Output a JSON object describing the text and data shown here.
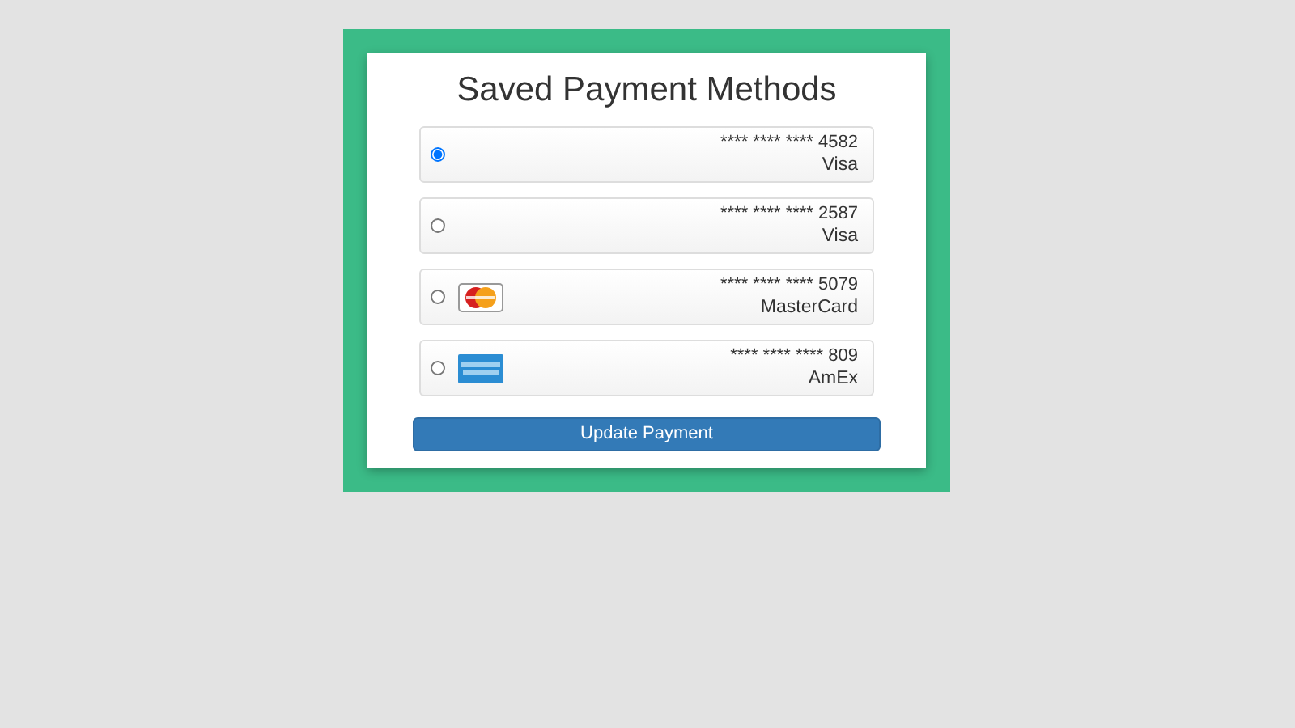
{
  "title": "Saved Payment Methods",
  "methods": [
    {
      "number": "**** **** **** 4582",
      "brand": "Visa",
      "selected": true,
      "kind": "none"
    },
    {
      "number": "**** **** **** 2587",
      "brand": "Visa",
      "selected": false,
      "kind": "none"
    },
    {
      "number": "**** **** **** 5079",
      "brand": "MasterCard",
      "selected": false,
      "kind": "mastercard"
    },
    {
      "number": "**** **** **** 809",
      "brand": "AmEx",
      "selected": false,
      "kind": "amex"
    }
  ],
  "button": "Update Payment"
}
